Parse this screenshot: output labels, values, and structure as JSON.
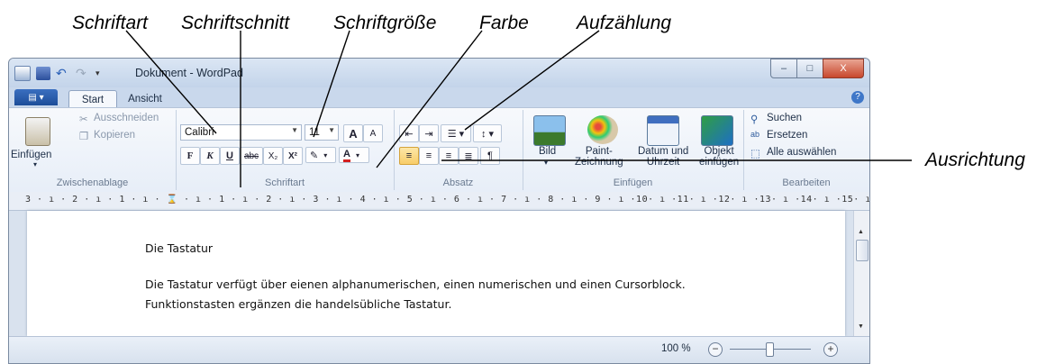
{
  "callouts": {
    "font": "Schriftart",
    "style": "Schriftschnitt",
    "size": "Schriftgröße",
    "color": "Farbe",
    "list": "Aufzählung",
    "align": "Ausrichtung"
  },
  "window": {
    "title": "Dokument - WordPad",
    "controls": {
      "minimize": "–",
      "maximize": "□",
      "close": "X"
    }
  },
  "tabs": {
    "app_menu": "▤ ▾",
    "start": "Start",
    "view": "Ansicht",
    "help": "?"
  },
  "clipboard": {
    "paste": "Einfügen",
    "cut": "Ausschneiden",
    "copy": "Kopieren",
    "label": "Zwischenablage"
  },
  "font_group": {
    "font_name": "Calibri",
    "font_size": "11",
    "grow": "A",
    "shrink": "A",
    "bold": "F",
    "italic": "K",
    "underline": "U",
    "strike": "abc",
    "subscript": "X₂",
    "superscript": "X²",
    "highlight": "✎",
    "color": "A",
    "label": "Schriftart"
  },
  "paragraph": {
    "label": "Absatz"
  },
  "insert": {
    "picture": "Bild",
    "paint": "Paint-\nZeichnung",
    "paint_l1": "Paint-",
    "paint_l2": "Zeichnung",
    "date_l1": "Datum und",
    "date_l2": "Uhrzeit",
    "object_l1": "Objekt",
    "object_l2": "einfügen",
    "label": "Einfügen"
  },
  "editing": {
    "find": "Suchen",
    "replace": "Ersetzen",
    "select_all": "Alle auswählen",
    "label": "Bearbeiten"
  },
  "ruler": "3 · ı · 2 · ı · 1 · ı · ⌛ · ı · 1 · ı · 2 · ı · 3 · ı · 4 · ı · 5 · ı · 6 · ı · 7 · ı · 8 · ı · 9 · ı ·10· ı ·11· ı ·12· ı ·13· ı ·14· ı ·15· ı ·16· ı ·17· ı ·18·",
  "document": {
    "heading": "Die Tastatur",
    "line1": "Die Tastatur verfügt über eienen alphanumerischen, einen numerischen und einen Cursorblock.",
    "line2": "Funktionstasten ergänzen die handelsübliche Tastatur."
  },
  "status": {
    "zoom": "100 %",
    "zoom_out": "−",
    "zoom_in": "+"
  },
  "colors": {
    "accent_blue": "#1d4d99",
    "selected_orange": "#f8cd69",
    "font_color_red": "#d42020"
  }
}
